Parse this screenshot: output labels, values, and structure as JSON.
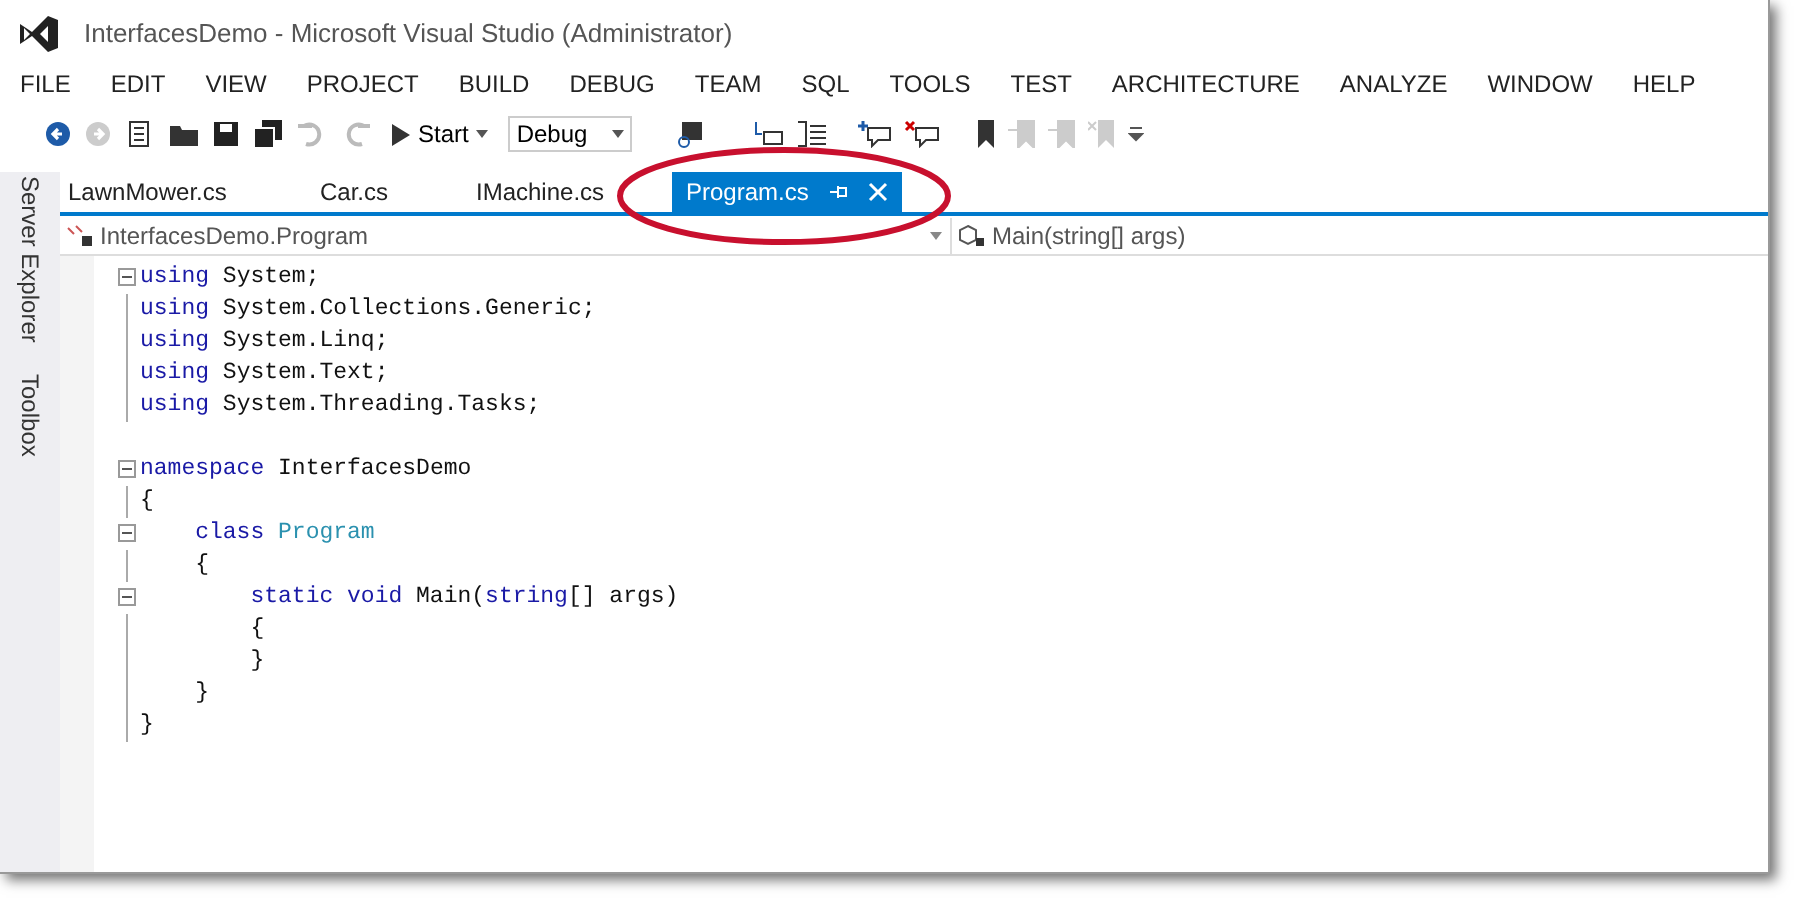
{
  "window": {
    "title": "InterfacesDemo - Microsoft Visual Studio (Administrator)"
  },
  "menu": [
    "FILE",
    "EDIT",
    "VIEW",
    "PROJECT",
    "BUILD",
    "DEBUG",
    "TEAM",
    "SQL",
    "TOOLS",
    "TEST",
    "ARCHITECTURE",
    "ANALYZE",
    "WINDOW",
    "HELP"
  ],
  "toolbar": {
    "start_label": "Start",
    "configuration": "Debug"
  },
  "side_tabs": [
    "Server Explorer",
    "Toolbox"
  ],
  "tabs": [
    {
      "label": "LawnMower.cs",
      "selected": false
    },
    {
      "label": "Car.cs",
      "selected": false
    },
    {
      "label": "IMachine.cs",
      "selected": false
    },
    {
      "label": "Program.cs",
      "selected": true
    }
  ],
  "navigation": {
    "type_dropdown": "InterfacesDemo.Program",
    "member_dropdown": "Main(string[] args)"
  },
  "code_lines": [
    {
      "collapsible": true,
      "guide": false,
      "tokens": [
        {
          "text": "using",
          "kind": "keyword"
        },
        {
          "text": " System;",
          "kind": "plain"
        }
      ]
    },
    {
      "collapsible": false,
      "guide": true,
      "tokens": [
        {
          "text": "using",
          "kind": "keyword"
        },
        {
          "text": " System.Collections.Generic;",
          "kind": "plain"
        }
      ]
    },
    {
      "collapsible": false,
      "guide": true,
      "tokens": [
        {
          "text": "using",
          "kind": "keyword"
        },
        {
          "text": " System.Linq;",
          "kind": "plain"
        }
      ]
    },
    {
      "collapsible": false,
      "guide": true,
      "tokens": [
        {
          "text": "using",
          "kind": "keyword"
        },
        {
          "text": " System.Text;",
          "kind": "plain"
        }
      ]
    },
    {
      "collapsible": false,
      "guide": true,
      "tokens": [
        {
          "text": "using",
          "kind": "keyword"
        },
        {
          "text": " System.Threading.Tasks;",
          "kind": "plain"
        }
      ]
    },
    {
      "collapsible": false,
      "guide": false
    },
    {
      "collapsible": true,
      "guide": false,
      "tokens": [
        {
          "text": "namespace",
          "kind": "keyword"
        },
        {
          "text": " InterfacesDemo",
          "kind": "plain"
        }
      ]
    },
    {
      "collapsible": false,
      "guide": true,
      "tokens": [
        {
          "text": "{",
          "kind": "plain"
        }
      ]
    },
    {
      "collapsible": true,
      "guide": false,
      "tokens": [
        {
          "text": "    class",
          "kind": "keyword"
        },
        {
          "text": " Program",
          "kind": "type"
        }
      ]
    },
    {
      "collapsible": false,
      "guide": true,
      "tokens": [
        {
          "text": "    {",
          "kind": "plain"
        }
      ]
    },
    {
      "collapsible": true,
      "guide": false,
      "tokens": [
        {
          "text": "        static void",
          "kind": "keyword"
        },
        {
          "text": " Main(",
          "kind": "plain"
        },
        {
          "text": "string",
          "kind": "keyword"
        },
        {
          "text": "[] args)",
          "kind": "plain"
        }
      ]
    },
    {
      "collapsible": false,
      "guide": true,
      "tokens": [
        {
          "text": "        {",
          "kind": "plain"
        }
      ]
    },
    {
      "collapsible": false,
      "guide": true,
      "tokens": [
        {
          "text": "        }",
          "kind": "plain"
        }
      ]
    },
    {
      "collapsible": false,
      "guide": true,
      "tokens": [
        {
          "text": "    }",
          "kind": "plain"
        }
      ]
    },
    {
      "collapsible": false,
      "guide": true,
      "tokens": [
        {
          "text": "}",
          "kind": "plain"
        }
      ]
    }
  ]
}
